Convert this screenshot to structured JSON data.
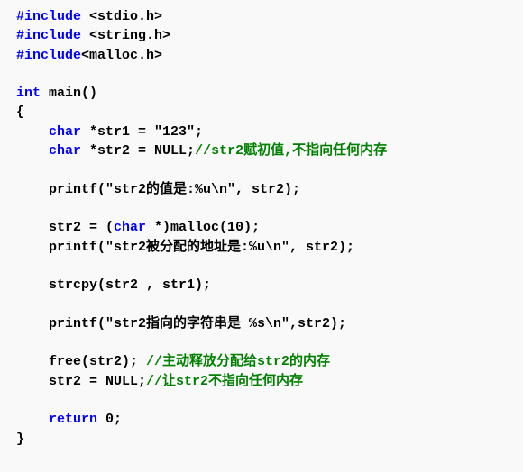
{
  "lines": {
    "l1_a": "#include",
    "l1_b": " <stdio.h>",
    "l2_a": "#include",
    "l2_b": " <string.h>",
    "l3_a": "#include",
    "l3_b": "<malloc.h>",
    "l4_a": "int",
    "l4_b": " main()",
    "l5": "{",
    "l6_a": "    ",
    "l6_b": "char",
    "l6_c": " *str1 = \"123\";",
    "l7_a": "    ",
    "l7_b": "char",
    "l7_c": " *str2 = NULL;",
    "l7_d": "//str2赋初值,不指向任何内存",
    "l8": "    printf(\"str2的值是:%u\\n\", str2);",
    "l9_a": "    str2 = (",
    "l9_b": "char",
    "l9_c": " *)malloc(10);",
    "l10": "    printf(\"str2被分配的地址是:%u\\n\", str2);",
    "l11": "    strcpy(str2 , str1);",
    "l12": "    printf(\"str2指向的字符串是 %s\\n\",str2);",
    "l13_a": "    free(str2); ",
    "l13_b": "//主动释放分配给str2的内存",
    "l14_a": "    str2 = NULL;",
    "l14_b": "//让str2不指向任何内存",
    "l15_a": "    ",
    "l15_b": "return",
    "l15_c": " 0;",
    "l16": "}"
  }
}
